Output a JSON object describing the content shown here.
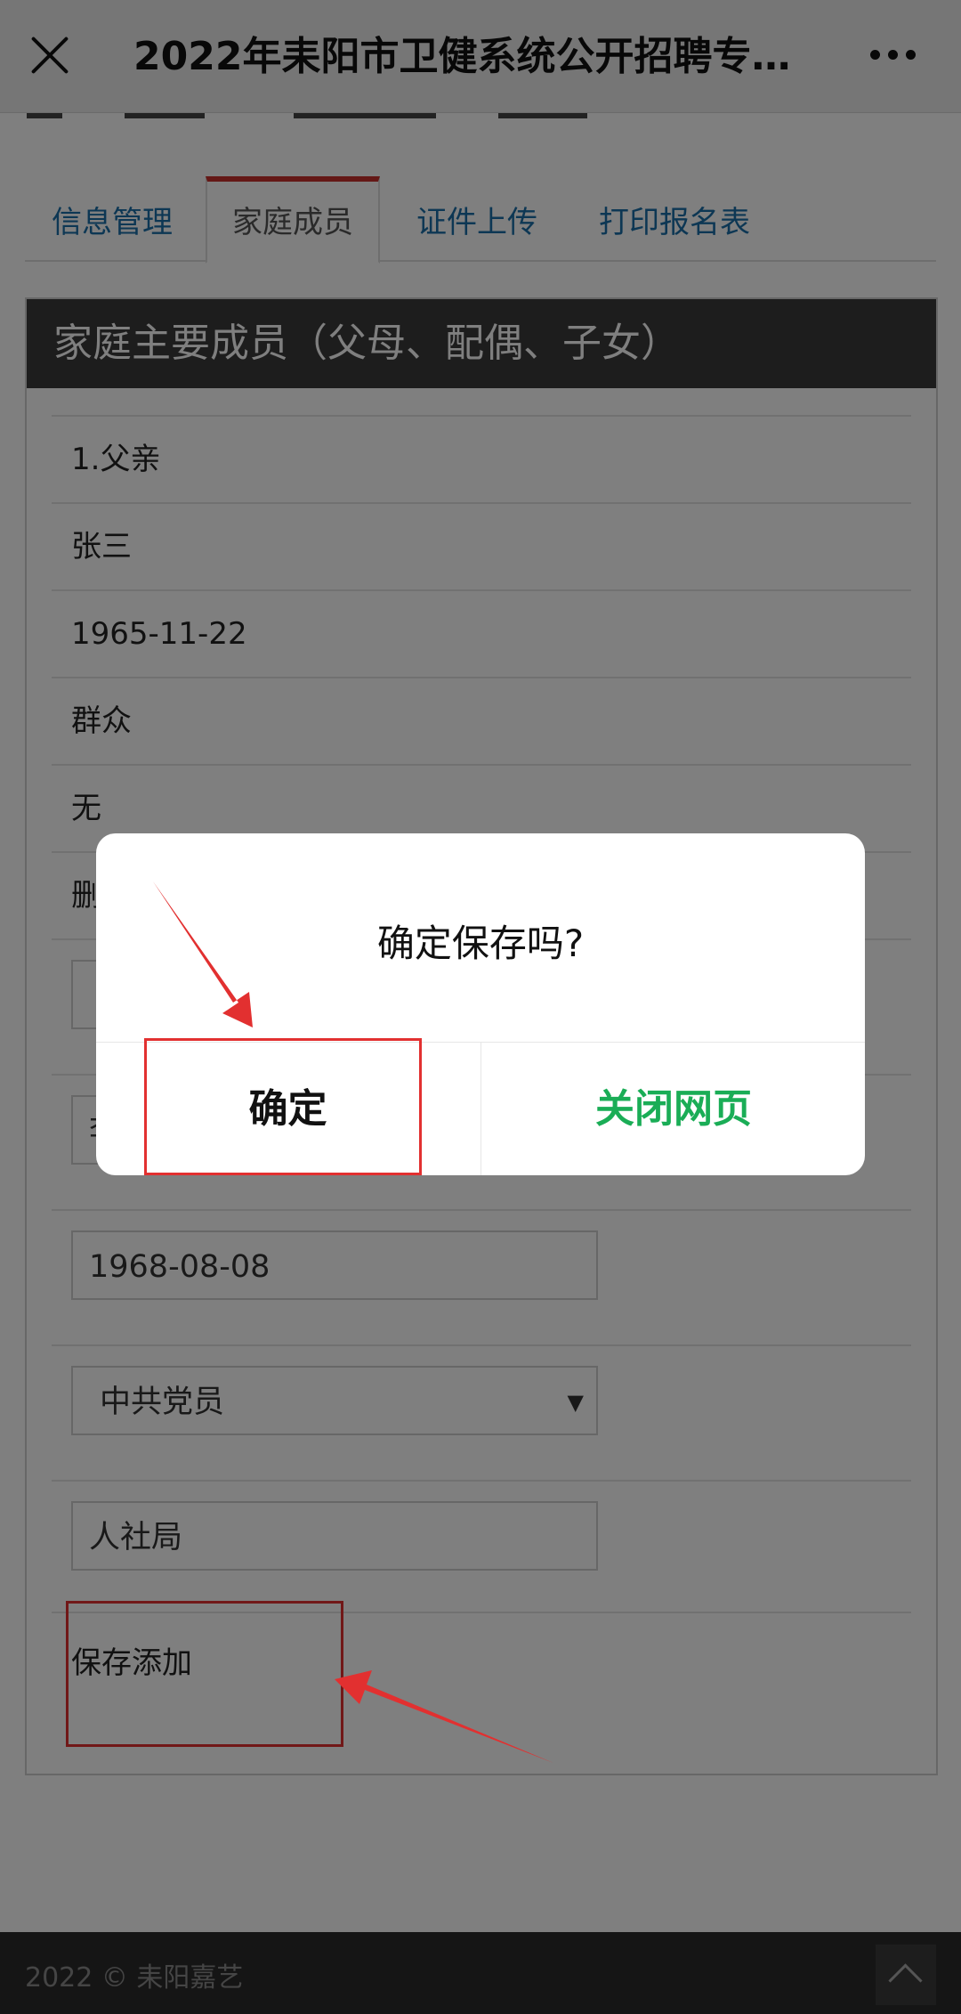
{
  "topbar": {
    "title": "2022年耒阳市卫健系统公开招聘专…"
  },
  "tabs": [
    {
      "label": "信息管理",
      "active": false
    },
    {
      "label": "家庭成员",
      "active": true
    },
    {
      "label": "证件上传",
      "active": false
    },
    {
      "label": "打印报名表",
      "active": false
    }
  ],
  "panel": {
    "heading": "家庭主要成员（父母、配偶、子女）",
    "member": {
      "relation": "1.父亲",
      "name": "张三",
      "birth_date": "1965-11-22",
      "political_status": "群众",
      "work_unit": "无",
      "action": "删除"
    },
    "form": {
      "name_partial": "李",
      "birth_date": "1968-08-08",
      "political_status": "中共党员",
      "work_unit": "人社局"
    },
    "save_label": "保存添加"
  },
  "footer": {
    "copyright": "2022 © 耒阳嘉艺"
  },
  "dialog": {
    "message": "确定保存吗?",
    "confirm_label": "确定",
    "close_label": "关闭网页"
  },
  "colors": {
    "accent_green": "#1aad56",
    "annotation_red": "#e23030",
    "tab_link": "#1a6ea8",
    "active_tab_bar": "#c9302c",
    "panel_header": "#3a3a3a"
  }
}
